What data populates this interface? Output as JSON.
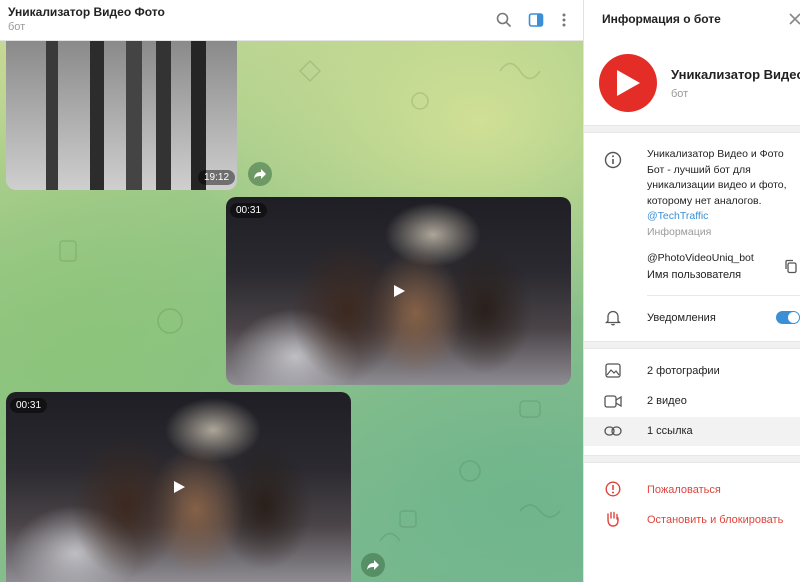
{
  "chat": {
    "title": "Уникализатор Видео Фото",
    "subtitle": "бот"
  },
  "messages": {
    "photo_time": "19:12",
    "video1_duration": "00:31",
    "video2_duration": "00:31"
  },
  "info_panel": {
    "title": "Информация о боте",
    "bot_name": "Уникализатор Видео Фото",
    "bot_subtitle": "бот",
    "description": "Уникализатор Видео и Фото Бот - лучший бот для уникализации видео и фото, которому нет аналогов.",
    "description_link": "@TechTraffic",
    "description_caption": "Информация",
    "username": "@PhotoVideoUniq_bot",
    "username_caption": "Имя пользователя",
    "notifications_label": "Уведомления",
    "notifications_on": true,
    "media_items": [
      {
        "label": "2 фотографии",
        "icon": "image-icon"
      },
      {
        "label": "2 видео",
        "icon": "video-icon"
      },
      {
        "label": "1 ссылка",
        "icon": "link-icon"
      }
    ],
    "report_label": "Пожаловаться",
    "block_label": "Остановить и блокировать"
  },
  "colors": {
    "accent": "#3a8fd6",
    "danger": "#e0443c",
    "avatar_bg": "#e52d27"
  }
}
